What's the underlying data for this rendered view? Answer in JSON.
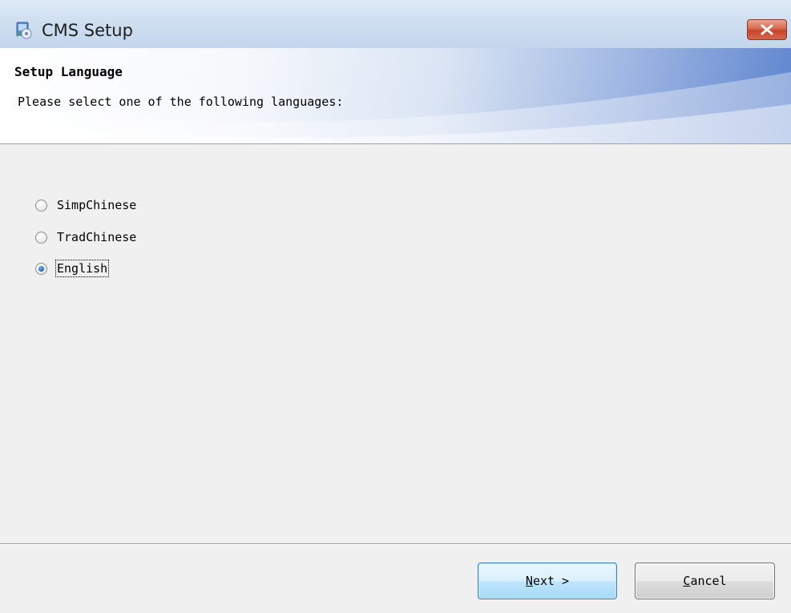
{
  "window": {
    "title": "CMS Setup",
    "close_icon": "close-icon"
  },
  "header": {
    "title": "Setup Language",
    "subtitle": "Please select one of the following languages:"
  },
  "languages": {
    "options": [
      {
        "label": "SimpChinese",
        "selected": false
      },
      {
        "label": "TradChinese",
        "selected": false
      },
      {
        "label": "English",
        "selected": true
      }
    ]
  },
  "footer": {
    "next": {
      "mnemonic": "N",
      "rest": "ext >"
    },
    "cancel": {
      "mnemonic": "C",
      "rest": "ancel"
    }
  },
  "colors": {
    "radio_checked": "#2a6fc4",
    "close_button": "#c7442a",
    "banner_accent": "#5f85cf"
  }
}
